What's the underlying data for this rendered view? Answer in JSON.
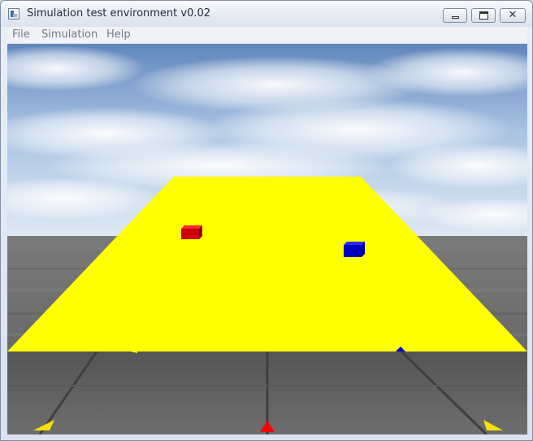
{
  "window": {
    "title": "Simulation test environment v0.02",
    "icon": "app-icon",
    "controls": {
      "minimize_icon": "minimize-icon",
      "maximize_icon": "maximize-icon",
      "close_icon": "close-icon",
      "close_glyph": "✕"
    }
  },
  "menu": {
    "items": [
      {
        "label": "File"
      },
      {
        "label": "Simulation"
      },
      {
        "label": "Help"
      }
    ]
  },
  "scene": {
    "sky_color": "#8fb0d8",
    "platform_color": "#ffff00",
    "ground_color": "#6a6a6a",
    "objects": [
      {
        "name": "red-cube",
        "color": "#d40000"
      },
      {
        "name": "blue-cube",
        "color": "#0000c8"
      }
    ],
    "markers": [
      {
        "name": "yellow-marker-left",
        "color": "#ffe000"
      },
      {
        "name": "red-marker-center",
        "color": "#ff0000"
      },
      {
        "name": "yellow-marker-right",
        "color": "#ffe000"
      }
    ]
  }
}
